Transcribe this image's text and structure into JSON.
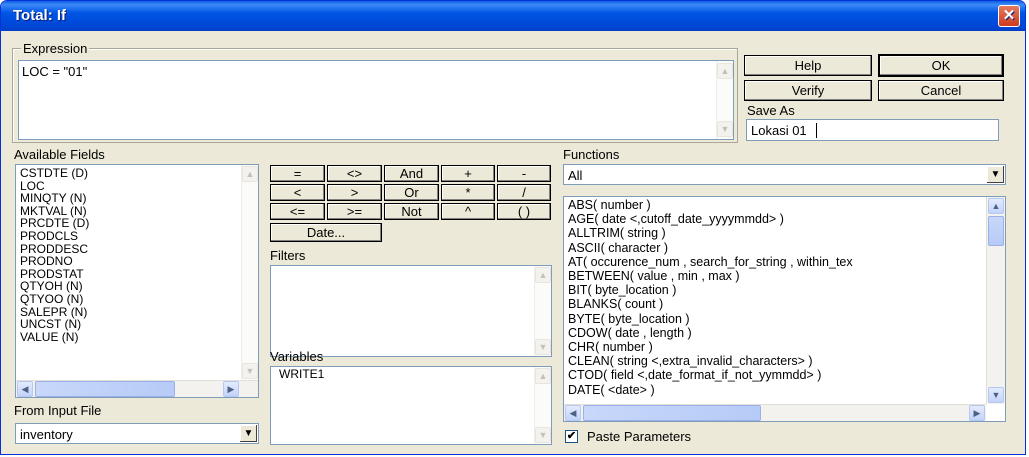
{
  "window": {
    "title": "Total: If",
    "close_icon": "✕"
  },
  "expression": {
    "group_label": "Expression",
    "value": "LOC = \"01\""
  },
  "buttons": {
    "help": "Help",
    "ok": "OK",
    "verify": "Verify",
    "cancel": "Cancel"
  },
  "save_as": {
    "label": "Save As",
    "value": "Lokasi 01"
  },
  "available_fields": {
    "label": "Available Fields",
    "items": [
      "CSTDTE (D)",
      "LOC",
      "MINQTY (N)",
      "MKTVAL (N)",
      "PRCDTE (D)",
      "PRODCLS",
      "PRODDESC",
      "PRODNO",
      "PRODSTAT",
      "QTYOH (N)",
      "QTYOO (N)",
      "SALEPR (N)",
      "UNCST (N)",
      "VALUE (N)"
    ]
  },
  "from_input_file": {
    "label": "From Input File",
    "value": "inventory"
  },
  "operators": {
    "row1": [
      "=",
      "<>",
      "And",
      "+",
      "-"
    ],
    "row2": [
      "<",
      ">",
      "Or",
      "*",
      "/"
    ],
    "row3": [
      "<=",
      ">=",
      "Not",
      "^",
      "( )"
    ],
    "date": "Date..."
  },
  "filters": {
    "label": "Filters"
  },
  "variables": {
    "label": "Variables",
    "items": [
      "WRITE1"
    ]
  },
  "functions": {
    "label": "Functions",
    "category": "All",
    "items": [
      "ABS( number )",
      "AGE( date <,cutoff_date_yyyymmdd> )",
      "ALLTRIM( string )",
      "ASCII( character )",
      "AT( occurence_num , search_for_string , within_tex",
      "BETWEEN( value , min , max )",
      "BIT( byte_location )",
      "BLANKS( count )",
      "BYTE( byte_location )",
      "CDOW( date , length )",
      "CHR( number )",
      "CLEAN( string <,extra_invalid_characters> )",
      "CTOD( field <,date_format_if_not_yymmdd> )",
      "DATE( <date> )"
    ]
  },
  "paste_parameters": {
    "label": "Paste Parameters",
    "checked": true,
    "check_glyph": "✔"
  },
  "icons": {
    "scroll_up": "▲",
    "scroll_down": "▼",
    "scroll_left": "◀",
    "scroll_right": "▶",
    "dropdown": "▼"
  }
}
